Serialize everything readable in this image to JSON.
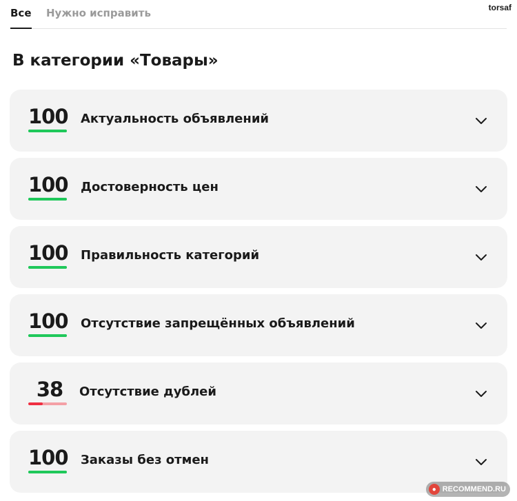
{
  "tabs": [
    {
      "label": "Все",
      "active": true
    },
    {
      "label": "Нужно исправить",
      "active": false
    }
  ],
  "user": {
    "name": "torsaf"
  },
  "section": {
    "title": "В категории «Товары»"
  },
  "rows": [
    {
      "score": "100",
      "progress": 1.0,
      "label": "Актуальность объявлений"
    },
    {
      "score": "100",
      "progress": 1.0,
      "label": "Достоверность цен"
    },
    {
      "score": "100",
      "progress": 1.0,
      "label": "Правильность категорий"
    },
    {
      "score": "100",
      "progress": 1.0,
      "label": "Отсутствие запрещённых объявлений"
    },
    {
      "score": "38",
      "progress": 0.38,
      "label": "Отсутствие дублей"
    },
    {
      "score": "100",
      "progress": 1.0,
      "label": "Заказы без отмен"
    }
  ],
  "colors": {
    "good": "#1fc85a",
    "bad": "#ef2f42",
    "bad_track": "#f4a0a6",
    "card": "#f3f3f3"
  },
  "watermark": {
    "text": "RECOMMEND.RU",
    "icon": "otzovik-logo-icon"
  }
}
